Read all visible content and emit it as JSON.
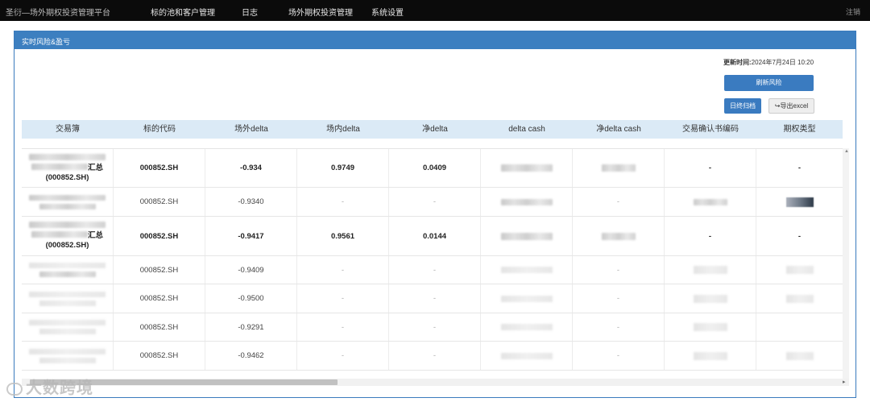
{
  "navbar": {
    "brand": "圣衍—场外期权投资管理平台",
    "items": [
      "标的池和客户管理",
      "日志",
      "场外期权投资管理",
      "系统设置"
    ],
    "logout": "注销"
  },
  "panel": {
    "title": "实时风险&盈亏",
    "update_label": "更新时间:",
    "update_value": "2024年7月24日 10:20",
    "refresh_button": "刷新风险",
    "archive_button": "日终归档",
    "export_button": "导出excel"
  },
  "table": {
    "headers": [
      "交易簿",
      "标的代码",
      "场外delta",
      "场内delta",
      "净delta",
      "delta cash",
      "净delta cash",
      "交易确认书编码",
      "期权类型"
    ],
    "rows": [
      {
        "summary": true,
        "book_suffix": "汇总",
        "book_code": "(000852.SH)",
        "code": "000852.SH",
        "otc_delta": "-0.934",
        "ex_delta": "0.9749",
        "net_delta": "0.0409",
        "confirm": "-",
        "option_type": "-"
      },
      {
        "summary": false,
        "code": "000852.SH",
        "otc_delta": "-0.9340",
        "ex_delta": "-",
        "net_delta": "-",
        "net_delta_cash": "-"
      },
      {
        "summary": true,
        "book_suffix": "汇总",
        "book_code": "(000852.SH)",
        "code": "000852.SH",
        "otc_delta": "-0.9417",
        "ex_delta": "0.9561",
        "net_delta": "0.0144",
        "confirm": "-",
        "option_type": "-"
      },
      {
        "summary": false,
        "code": "000852.SH",
        "otc_delta": "-0.9409",
        "ex_delta": "-",
        "net_delta": "-",
        "net_delta_cash": "-"
      },
      {
        "summary": false,
        "code": "000852.SH",
        "otc_delta": "-0.9500",
        "ex_delta": "-",
        "net_delta": "-",
        "net_delta_cash": "-"
      },
      {
        "summary": false,
        "code": "000852.SH",
        "otc_delta": "-0.9291",
        "ex_delta": "-",
        "net_delta": "-",
        "net_delta_cash": "-"
      },
      {
        "summary": false,
        "code": "000852.SH",
        "otc_delta": "-0.9462",
        "ex_delta": "-",
        "net_delta": "-",
        "net_delta_cash": "-"
      }
    ]
  },
  "watermark": "大数跨境"
}
